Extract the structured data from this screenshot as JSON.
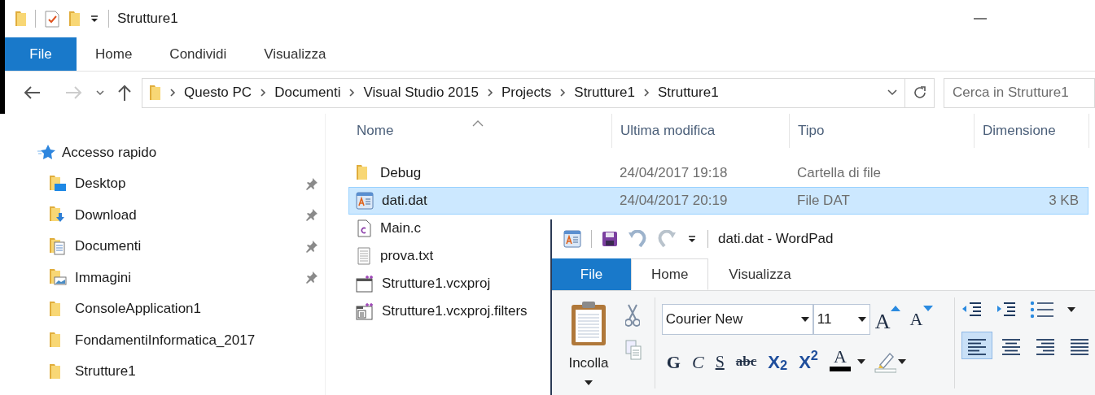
{
  "explorer": {
    "title": "Strutture1",
    "tabs": [
      {
        "label": "File",
        "kind": "file",
        "selected": false
      },
      {
        "label": "Home",
        "kind": "plain",
        "selected": false
      },
      {
        "label": "Condividi",
        "kind": "plain",
        "selected": false
      },
      {
        "label": "Visualizza",
        "kind": "plain",
        "selected": false
      }
    ],
    "address": [
      "Questo PC",
      "Documenti",
      "Visual Studio 2015",
      "Projects",
      "Strutture1",
      "Strutture1"
    ],
    "search": {
      "placeholder": "Cerca in Strutture1"
    },
    "quick_access": "Accesso rapido",
    "nav_items": [
      {
        "label": "Desktop",
        "kind": "desktop",
        "pinned": true
      },
      {
        "label": "Download",
        "kind": "download",
        "pinned": true
      },
      {
        "label": "Documenti",
        "kind": "documents",
        "pinned": true
      },
      {
        "label": "Immagini",
        "kind": "pictures",
        "pinned": true
      },
      {
        "label": "ConsoleApplication1",
        "kind": "folder",
        "pinned": false
      },
      {
        "label": "FondamentiInformatica_2017",
        "kind": "folder",
        "pinned": false
      },
      {
        "label": "Strutture1",
        "kind": "folder",
        "pinned": false
      }
    ],
    "columns": [
      {
        "label": "Nome",
        "sorted": true
      },
      {
        "label": "Ultima modifica",
        "sorted": false
      },
      {
        "label": "Tipo",
        "sorted": false
      },
      {
        "label": "Dimensione",
        "sorted": false
      }
    ],
    "rows": [
      {
        "name": "Debug",
        "kind": "folder",
        "modified": "24/04/2017 19:18",
        "type": "Cartella di file",
        "selected": false
      },
      {
        "name": "dati.dat",
        "kind": "wordpad",
        "modified": "24/04/2017 20:19",
        "type": "File DAT",
        "size": "3 KB",
        "selected": true
      },
      {
        "name": "Main.c",
        "kind": "c",
        "selected": false
      },
      {
        "name": "prova.txt",
        "kind": "text",
        "selected": false
      },
      {
        "name": "Strutture1.vcxproj",
        "kind": "project",
        "selected": false
      },
      {
        "name": "Strutture1.vcxproj.filters",
        "kind": "filters",
        "selected": false
      }
    ]
  },
  "wordpad": {
    "title": "dati.dat - WordPad",
    "tabs": [
      {
        "label": "File",
        "kind": "file",
        "selected": false
      },
      {
        "label": "Home",
        "kind": "plain",
        "selected": true
      },
      {
        "label": "Visualizza",
        "kind": "plain",
        "selected": false
      }
    ],
    "paste_label": "Incolla",
    "font_name": "Courier New",
    "font_size": "11",
    "grow_label": "A",
    "shrink_label": "A",
    "format": [
      {
        "kind": "bold",
        "label": "G"
      },
      {
        "kind": "italic",
        "label": "C"
      },
      {
        "kind": "underline",
        "label": "S"
      },
      {
        "kind": "strike",
        "label": "abc"
      },
      {
        "kind": "subscript",
        "label": "X$_{2}$"
      },
      {
        "kind": "superscript",
        "label": "X$^{2}$"
      }
    ],
    "font_color_label": "A",
    "alignment": [
      {
        "kind": "left",
        "selected": true
      },
      {
        "kind": "center",
        "selected": false
      },
      {
        "kind": "right",
        "selected": false
      },
      {
        "kind": "justify",
        "selected": false
      }
    ]
  }
}
